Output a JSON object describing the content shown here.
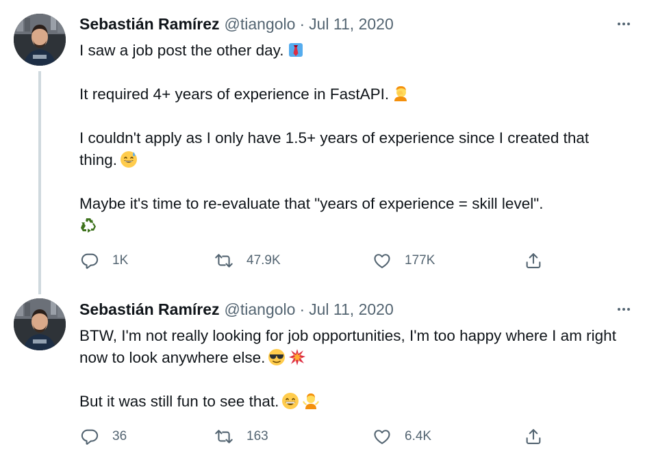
{
  "tweets": [
    {
      "author": "Sebastián Ramírez",
      "handle": "@tiangolo",
      "separator": "·",
      "date": "Jul 11, 2020",
      "paragraphs": [
        {
          "text": "I saw a job post the other day.",
          "emoji": "necktie-emoji"
        },
        {
          "text": "It required 4+ years of experience in FastAPI.",
          "emoji": "facepalm-emoji"
        },
        {
          "text": "I couldn't apply as I only have 1.5+ years of experience since I created that thing.",
          "emoji": "sweat-smile-emoji"
        },
        {
          "text": "Maybe it's time to re-evaluate that \"years of experience = skill level\".",
          "emoji": "recycle-emoji"
        }
      ],
      "stats": {
        "replies": "1K",
        "retweets": "47.9K",
        "likes": "177K"
      }
    },
    {
      "author": "Sebastián Ramírez",
      "handle": "@tiangolo",
      "separator": "·",
      "date": "Jul 11, 2020",
      "paragraphs": [
        {
          "text": "BTW, I'm not really looking for job opportunities, I'm too happy where I am right now to look anywhere else.",
          "emoji": "sunglasses-emoji, collision-emoji"
        },
        {
          "text": "But it was still fun to see that.",
          "emoji": "grin-emoji, shrug-emoji"
        }
      ],
      "stats": {
        "replies": "36",
        "retweets": "163",
        "likes": "6.4K"
      }
    }
  ],
  "colors": {
    "text": "#0f1419",
    "secondary": "#536471",
    "thread_line": "#cfd9de",
    "background": "#ffffff"
  },
  "icons": [
    "reply-icon",
    "retweet-icon",
    "like-icon",
    "share-icon",
    "more-icon"
  ]
}
